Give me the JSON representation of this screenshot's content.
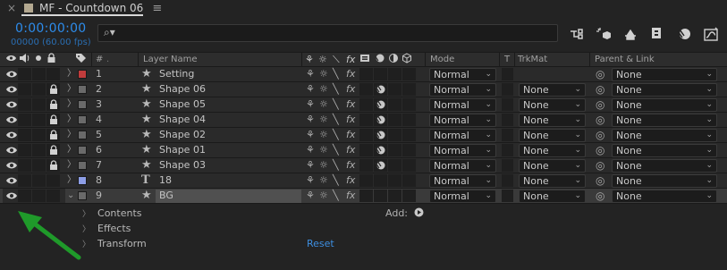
{
  "title_bar": {
    "close_glyph": "×",
    "tab_name": "MF - Countdown 06",
    "menu_glyph": "≡"
  },
  "timecode": {
    "time": "0:00:00:00",
    "frame_fps": "00000 (60.00 fps)"
  },
  "search": {
    "icon": "search-icon",
    "glyph": "⌕▾"
  },
  "columns": {
    "hash": "#",
    "layer_name": "Layer Name",
    "mode": "Mode",
    "t": "T",
    "trkmat": "TrkMat",
    "parent_link": "Parent & Link"
  },
  "layers": [
    {
      "num": "1",
      "name": "Setting",
      "type": "star",
      "color": "#c13c3c",
      "locked": false,
      "has_trkmat": false,
      "mode": "Normal",
      "parent": "None",
      "fx_blob": false
    },
    {
      "num": "2",
      "name": "Shape 06",
      "type": "star",
      "color": "#6a6a6a",
      "locked": true,
      "has_trkmat": true,
      "mode": "Normal",
      "trkmat": "None",
      "parent": "None",
      "fx_blob": true
    },
    {
      "num": "3",
      "name": "Shape 05",
      "type": "star",
      "color": "#6a6a6a",
      "locked": true,
      "has_trkmat": true,
      "mode": "Normal",
      "trkmat": "None",
      "parent": "None",
      "fx_blob": true
    },
    {
      "num": "4",
      "name": "Shape 04",
      "type": "star",
      "color": "#6a6a6a",
      "locked": true,
      "has_trkmat": true,
      "mode": "Normal",
      "trkmat": "None",
      "parent": "None",
      "fx_blob": true
    },
    {
      "num": "5",
      "name": "Shape 02",
      "type": "star",
      "color": "#6a6a6a",
      "locked": true,
      "has_trkmat": true,
      "mode": "Normal",
      "trkmat": "None",
      "parent": "None",
      "fx_blob": true
    },
    {
      "num": "6",
      "name": "Shape 01",
      "type": "star",
      "color": "#6a6a6a",
      "locked": true,
      "has_trkmat": true,
      "mode": "Normal",
      "trkmat": "None",
      "parent": "None",
      "fx_blob": true
    },
    {
      "num": "7",
      "name": "Shape 03",
      "type": "star",
      "color": "#6a6a6a",
      "locked": true,
      "has_trkmat": true,
      "mode": "Normal",
      "trkmat": "None",
      "parent": "None",
      "fx_blob": true
    },
    {
      "num": "8",
      "name": "18",
      "type": "text",
      "color": "#8d9ee6",
      "locked": false,
      "has_trkmat": true,
      "mode": "Normal",
      "trkmat": "None",
      "parent": "None",
      "fx_blob": false
    },
    {
      "num": "9",
      "name": "BG",
      "type": "star",
      "color": "#6a6a6a",
      "locked": false,
      "has_trkmat": true,
      "mode": "Normal",
      "trkmat": "None",
      "parent": "None",
      "fx_blob": false,
      "selected": true
    }
  ],
  "properties": {
    "contents": "Contents",
    "add_label": "Add:",
    "effects": "Effects",
    "transform": "Transform",
    "reset": "Reset"
  },
  "colors": {
    "accent_blue": "#2d8ceb",
    "annotation_green": "#1f9a2a"
  },
  "switch_glyphs": {
    "shy": "⚘",
    "collapse": "☼",
    "quality": "╲",
    "fx": "fx",
    "select_chev": "⌄"
  }
}
